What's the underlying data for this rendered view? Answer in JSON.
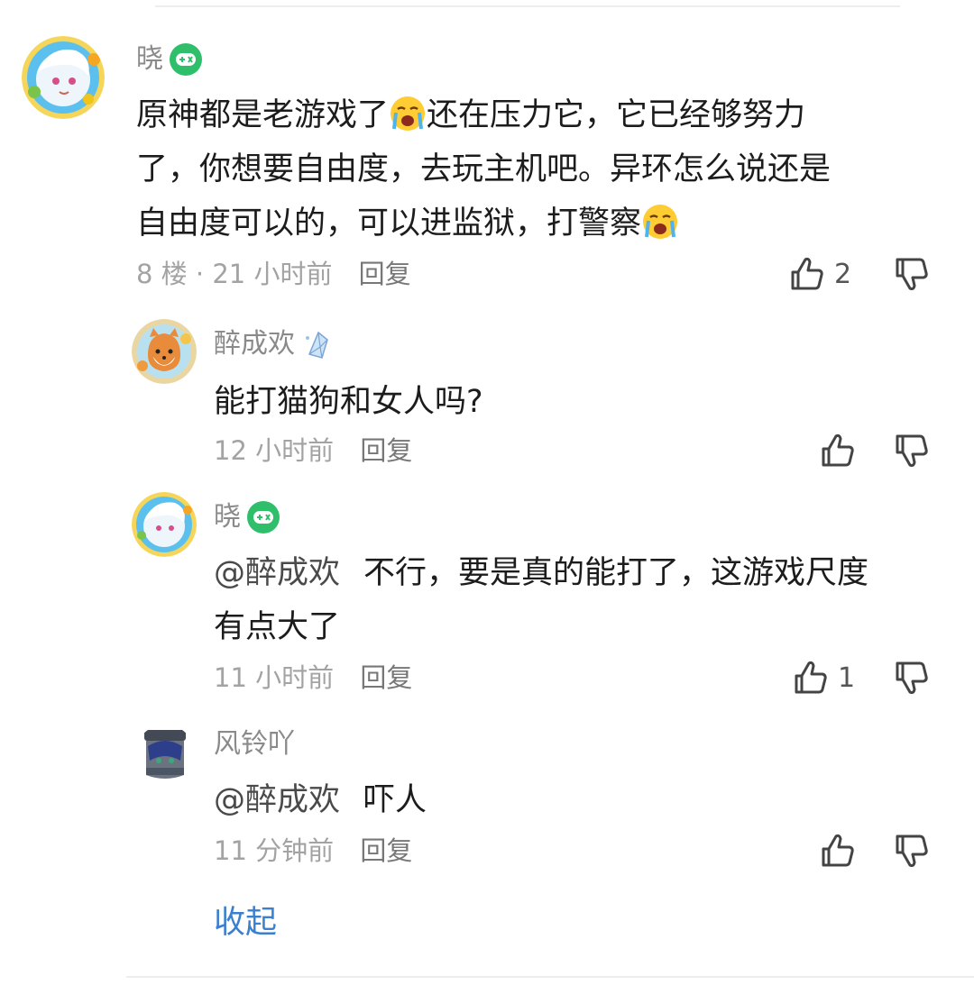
{
  "comments": [
    {
      "username": "晓",
      "badge": "gamepad-badge-icon",
      "text_lines": [
        "原神都是老游戏了",
        "还在压力它，它已经够努力",
        "了，你想要自由度，去玩主机吧。异环怎么说还是",
        "自由度可以的，可以进监狱，打警察"
      ],
      "floor": "8 楼",
      "dot": "·",
      "time": "21 小时前",
      "reply_label": "回复",
      "likes": "2"
    }
  ],
  "replies": [
    {
      "username": "醉成欢",
      "badge": "crystal-badge-icon",
      "text": "能打猫狗和女人吗?",
      "time": "12 小时前",
      "reply_label": "回复",
      "likes": ""
    },
    {
      "username": "晓",
      "badge": "gamepad-badge-icon",
      "mention": "@醉成欢",
      "text_lines": [
        "不行，要是真的能打了，这游戏尺度",
        "有点大了"
      ],
      "time": "11 小时前",
      "reply_label": "回复",
      "likes": "1"
    },
    {
      "username": "风铃吖",
      "mention": "@醉成欢",
      "text": "吓人",
      "time": "11 分钟前",
      "reply_label": "回复",
      "likes": ""
    }
  ],
  "collapse_label": "收起",
  "colors": {
    "accent": "#3b7fd1",
    "badge_green": "#2fbf6b",
    "meta": "#a3a3a3"
  }
}
